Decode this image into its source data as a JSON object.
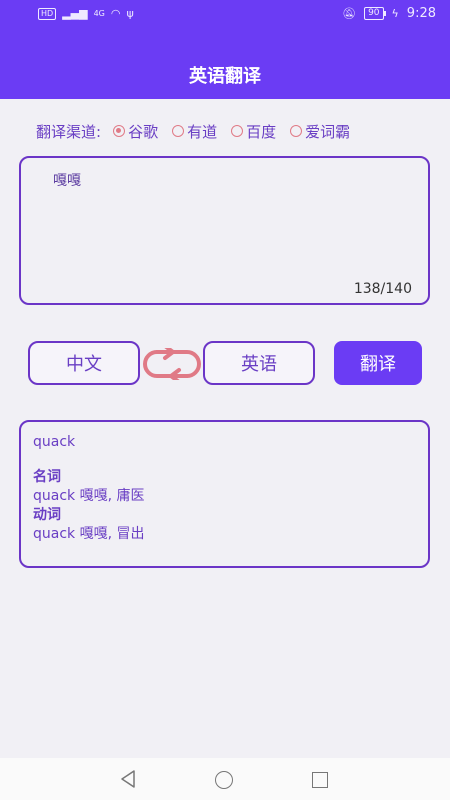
{
  "status_bar": {
    "left_badges": [
      "HD",
      "4G"
    ],
    "battery": "90",
    "time": "9:28"
  },
  "header": {
    "title": "英语翻译"
  },
  "channel": {
    "label": "翻译渠道:",
    "options": [
      "谷歌",
      "有道",
      "百度",
      "爱词霸"
    ],
    "selected": "谷歌"
  },
  "input": {
    "text": "嘎嘎",
    "counter": "138/140"
  },
  "languages": {
    "source": "中文",
    "target": "英语",
    "translate_label": "翻译"
  },
  "result": {
    "word": "quack",
    "sections": [
      {
        "pos": "名词",
        "def": "quack 嘎嘎, 庸医"
      },
      {
        "pos": "动词",
        "def": "quack 嘎嘎, 冒出"
      }
    ]
  },
  "colors": {
    "primary": "#6b3cf4",
    "border": "#6b35c7",
    "accent_radio": "#e07a86",
    "background": "#f1f0f5"
  }
}
